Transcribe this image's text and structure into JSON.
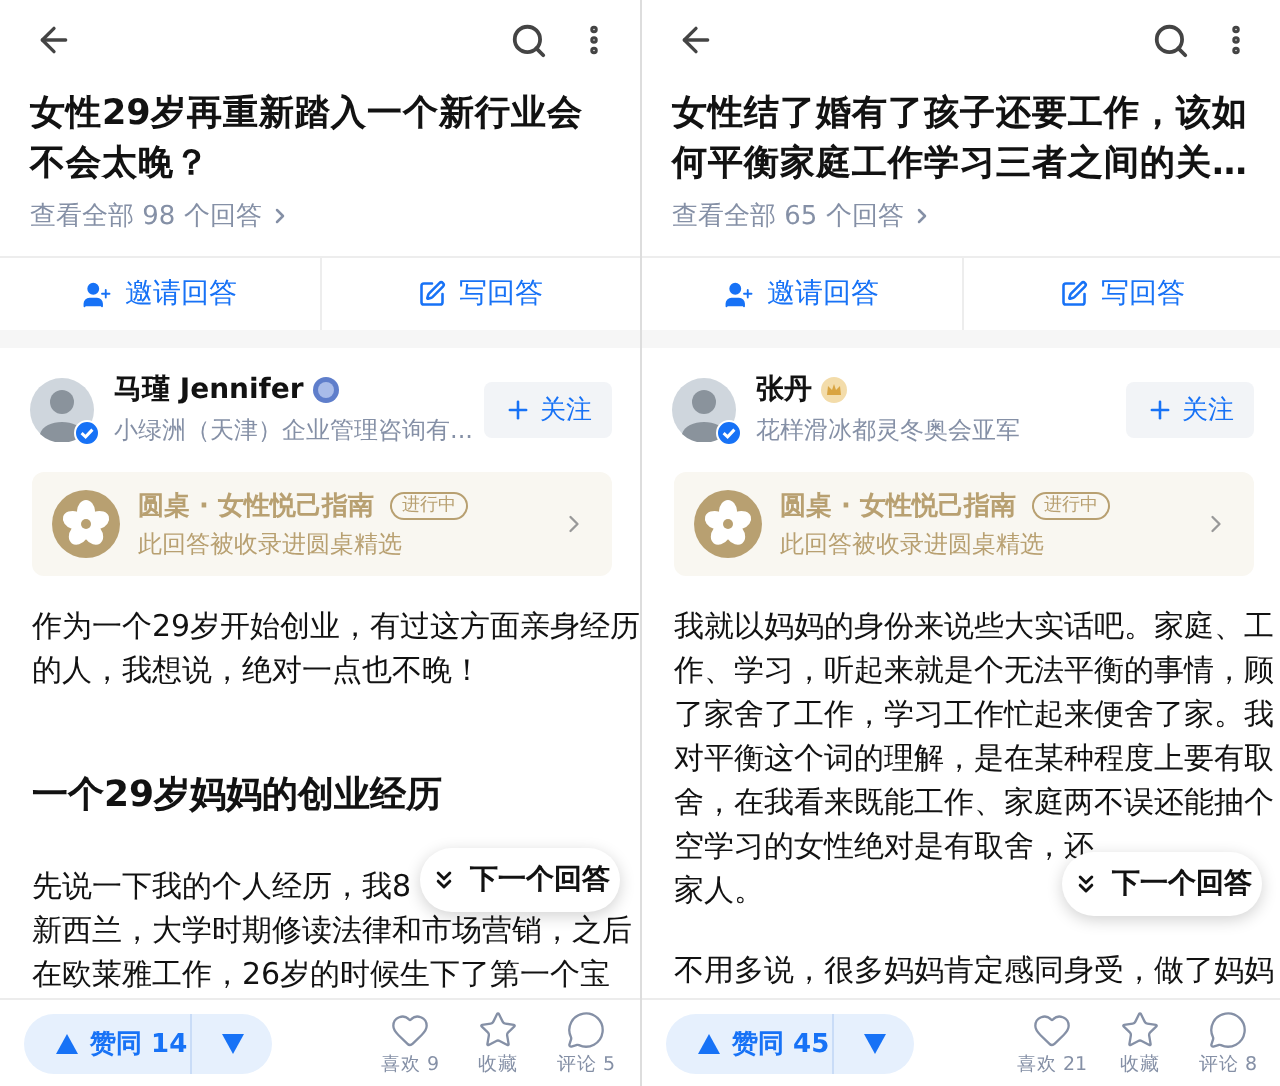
{
  "screens": [
    {
      "title": "女性29岁再重新踏入一个新行业会不会太晚？",
      "all_answers": "查看全部 98 个回答",
      "actions": [
        {
          "kind": "invite",
          "label": "邀请回答"
        },
        {
          "kind": "write",
          "label": "写回答"
        }
      ],
      "author": {
        "name": "马瑾 Jennifer",
        "badge": {
          "kind": "medal"
        },
        "bio": "小绿洲（天津）企业管理咨询有...",
        "follow": "关注"
      },
      "roundtable": {
        "title": "圆桌 · 女性悦己指南",
        "status": "进行中",
        "note": "此回答被收录进圆桌精选"
      },
      "blocks": [
        {
          "kind": "paragraph",
          "lines": [
            "作为一个29岁开始创业，有过这方面亲身经历",
            "的人，我想说，绝对一点也不晚！"
          ]
        },
        {
          "kind": "heading",
          "lines": [
            "一个29岁妈妈的创业经历"
          ]
        },
        {
          "kind": "paragraph_part",
          "lines": [
            "先说一下我的个人经历，我8"
          ]
        },
        {
          "kind": "floating_button",
          "label": "下一个回答"
        },
        {
          "kind": "paragraph",
          "lines": [
            "新西兰，大学时期修读法律和市场营销，之后",
            "在欧莱雅工作，26岁的时候生下了第一个宝"
          ]
        }
      ],
      "vote": "赞同 14",
      "stats": [
        {
          "kind": "like",
          "label": "喜欢 9"
        },
        {
          "kind": "collect",
          "label": "收藏"
        },
        {
          "kind": "comment",
          "label": "评论 5"
        }
      ]
    },
    {
      "title": "女性结了婚有了孩子还要工作，该如何平衡家庭工作学习三者之间的关…",
      "all_answers": "查看全部 65 个回答",
      "actions": [
        {
          "kind": "invite",
          "label": "邀请回答"
        },
        {
          "kind": "write",
          "label": "写回答"
        }
      ],
      "author": {
        "name": "张丹",
        "badge": {
          "kind": "crown"
        },
        "bio": "花样滑冰都灵冬奥会亚军",
        "follow": "关注"
      },
      "roundtable": {
        "title": "圆桌 · 女性悦己指南",
        "status": "进行中",
        "note": "此回答被收录进圆桌精选"
      },
      "blocks": [
        {
          "kind": "paragraph",
          "lines": [
            "我就以妈妈的身份来说些大实话吧。家庭、工",
            "作、学习，听起来就是个无法平衡的事情，顾",
            "了家舍了工作，学习工作忙起来便舍了家。我",
            "对平衡这个词的理解，是在某种程度上要有取",
            "舍，在我看来既能工作、家庭两不误还能抽个",
            "空学习的女性绝对是有取舍，还",
            "家人。"
          ]
        },
        {
          "kind": "floating_button",
          "label": "下一个回答"
        },
        {
          "kind": "paragraph",
          "lines": [
            "不用多说，很多妈妈肯定感同身受，做了妈妈"
          ]
        }
      ],
      "vote": "赞同 45",
      "stats": [
        {
          "kind": "like",
          "label": "喜欢 21"
        },
        {
          "kind": "collect",
          "label": "收藏"
        },
        {
          "kind": "comment",
          "label": "评论 8"
        }
      ]
    }
  ]
}
